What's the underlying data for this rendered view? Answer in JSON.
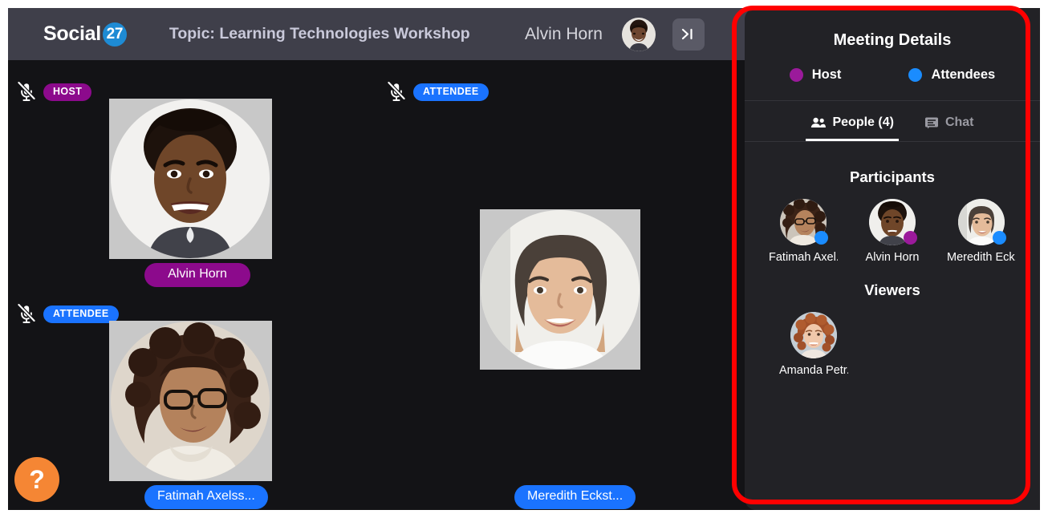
{
  "header": {
    "logo_text": "Social",
    "logo_badge": "27",
    "topic": "Topic: Learning Technologies Workshop",
    "user_name": "Alvin Horn",
    "avatar_icon": "user-avatar",
    "collapse_icon": "collapse-panel-icon",
    "collapse_glyph": "❯|"
  },
  "video_tiles": [
    {
      "role_badge": "HOST",
      "role_type": "host",
      "name_label": "Alvin Horn",
      "mic_icon": "mic-off-icon",
      "muted": true
    },
    {
      "role_badge": "ATTENDEE",
      "role_type": "attendee",
      "name_label": "Fatimah Axelss...",
      "mic_icon": "mic-off-icon",
      "muted": true
    },
    {
      "role_badge": "ATTENDEE",
      "role_type": "attendee",
      "name_label": "Meredith Eckst...",
      "mic_icon": "mic-off-icon",
      "muted": true
    }
  ],
  "help_button": {
    "glyph": "?",
    "icon": "help-question-icon"
  },
  "panel": {
    "title": "Meeting Details",
    "legend": [
      {
        "label": "Host",
        "color": "#9b1a9b"
      },
      {
        "label": "Attendees",
        "color": "#1a8cff"
      }
    ],
    "tabs": [
      {
        "label": "People (4)",
        "icon": "people-icon",
        "active": true
      },
      {
        "label": "Chat",
        "icon": "chat-bubble-icon",
        "active": false
      }
    ],
    "participants_title": "Participants",
    "participants": [
      {
        "name": "Fatimah Axel...",
        "status_color": "#1a8cff",
        "role": "attendee"
      },
      {
        "name": "Alvin Horn",
        "status_color": "#9b1a9b",
        "role": "host"
      },
      {
        "name": "Meredith Eck...",
        "status_color": "#1a8cff",
        "role": "attendee"
      }
    ],
    "viewers_title": "Viewers",
    "viewers": [
      {
        "name": "Amanda Petr...",
        "status_color": null,
        "role": "viewer"
      }
    ]
  },
  "annotation": {
    "name": "red-highlight-box",
    "color": "#ff0000"
  },
  "colors": {
    "host": "#8c0a8c",
    "attendee": "#1a73ff",
    "header_bg": "#3f3f4a",
    "stage_bg": "#131316",
    "panel_bg": "#222226",
    "help": "#f58634",
    "brand_blue": "#1e8bd4"
  }
}
